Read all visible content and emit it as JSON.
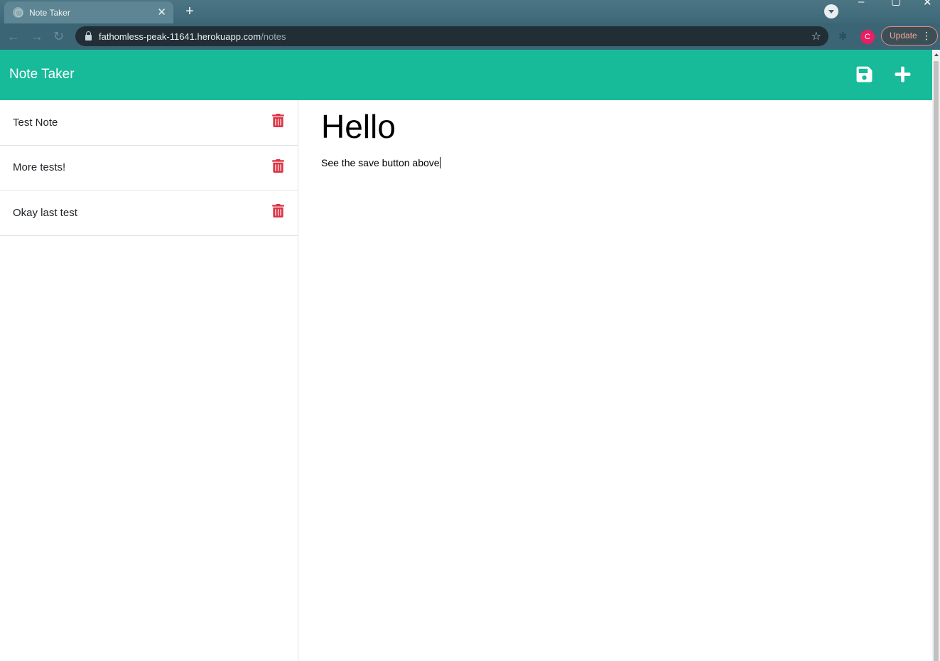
{
  "browser": {
    "tab_title": "Note Taker",
    "url_host": "fathomless-peak-11641.herokuapp.com",
    "url_path": "/notes",
    "profile_initial": "C",
    "update_label": "Update"
  },
  "app": {
    "brand": "Note Taker",
    "accent_color": "#17bb9a",
    "delete_color": "#dc3545"
  },
  "notes": [
    {
      "title": "Test Note"
    },
    {
      "title": "More tests!"
    },
    {
      "title": "Okay last test"
    }
  ],
  "editor": {
    "title": "Hello",
    "text": "See the save button above"
  }
}
